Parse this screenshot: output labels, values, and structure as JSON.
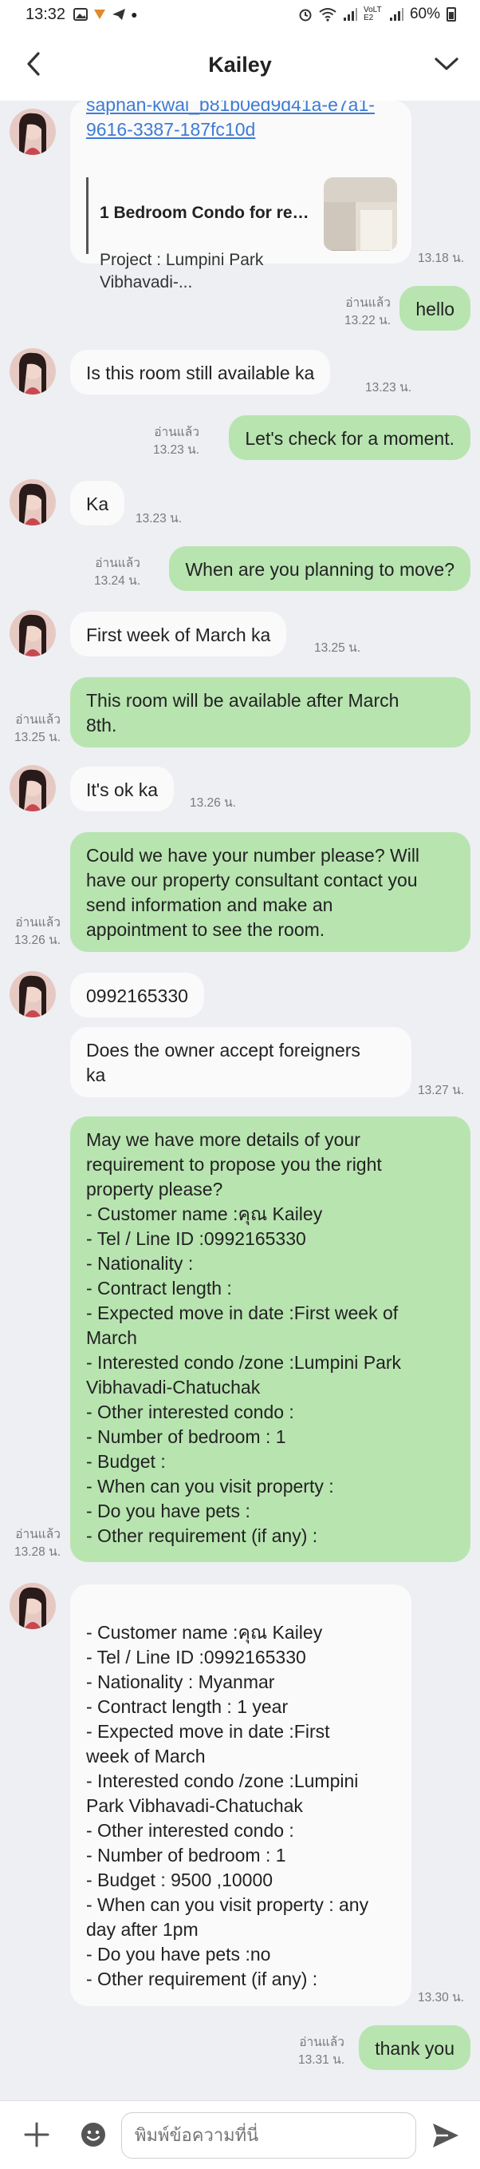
{
  "status_bar": {
    "time": "13:32",
    "battery": "60%",
    "network": "VoLTE2"
  },
  "header": {
    "title": "Kailey"
  },
  "messages": [
    {
      "link": "saphan-kwai_b81b0ed9d41a-e7a1-9616-3387-187fc10d",
      "preview_title": "1 Bedroom Condo for ren...",
      "preview_desc": "Project : Lumpini Park\nVibhavadi-...",
      "time": "13.18 น."
    },
    {
      "text": "hello",
      "read": "อ่านแล้ว",
      "time": "13.22 น."
    },
    {
      "text": "Is this room still available ka",
      "time": "13.23 น."
    },
    {
      "text": "Let's check for a moment.",
      "read": "อ่านแล้ว",
      "time": "13.23 น."
    },
    {
      "text": "Ka",
      "time": "13.23 น."
    },
    {
      "text": "When are you planning to move?",
      "read": "อ่านแล้ว",
      "time": "13.24 น."
    },
    {
      "text": "First week of March ka",
      "time": "13.25 น."
    },
    {
      "text": "This room will be available after March\n8th.",
      "read": "อ่านแล้ว",
      "time": "13.25 น."
    },
    {
      "text": "It's ok ka",
      "time": "13.26 น."
    },
    {
      "text": "Could we have your number please? Will\nhave our property consultant contact you\nsend information and make an\nappointment to see the room.",
      "read": "อ่านแล้ว",
      "time": "13.26 น."
    },
    {
      "text": "0992165330"
    },
    {
      "text": "Does the owner accept foreigners\nka",
      "time": "13.27 น."
    },
    {
      "text": "May we have more details of your\nrequirement to propose you the right\nproperty please?\n- Customer name :คุณ Kailey\n- Tel / Line ID :0992165330\n- Nationality :\n- Contract length :\n- Expected move in date :First week of\nMarch\n- Interested condo /zone :Lumpini Park\nVibhavadi-Chatuchak\n- Other interested condo :\n- Number of bedroom  : 1\n- Budget :\n- When can you visit property :\n- Do you have pets :\n- Other requirement (if any) :",
      "read": "อ่านแล้ว",
      "time": "13.28 น."
    },
    {
      "text": "\n- Customer name :คุณ Kailey\n- Tel / Line ID :0992165330\n- Nationality : Myanmar\n- Contract length : 1 year\n- Expected move in date :First\nweek of March\n- Interested condo /zone :Lumpini\nPark Vibhavadi-Chatuchak\n- Other interested condo :\n- Number of bedroom  : 1\n- Budget : 9500 ,10000\n- When can you visit property : any\nday after 1pm\n- Do you have pets :no\n- Other requirement (if any) :",
      "time": "13.30 น."
    },
    {
      "text": "thank you",
      "read": "อ่านแล้ว",
      "time": "13.31 น."
    }
  ],
  "composer": {
    "placeholder": "พิมพ์ข้อความที่นี่"
  },
  "icons": {
    "back": "chevron-left-icon",
    "menu": "chevron-down-icon",
    "plus": "plus-icon",
    "emoji": "emoji-icon",
    "send": "send-icon"
  },
  "colors": {
    "outgoing_bubble": "#b8e4b0",
    "incoming_bubble": "#fafafa",
    "chat_background": "#edeff3",
    "link": "#3e7bd6"
  }
}
